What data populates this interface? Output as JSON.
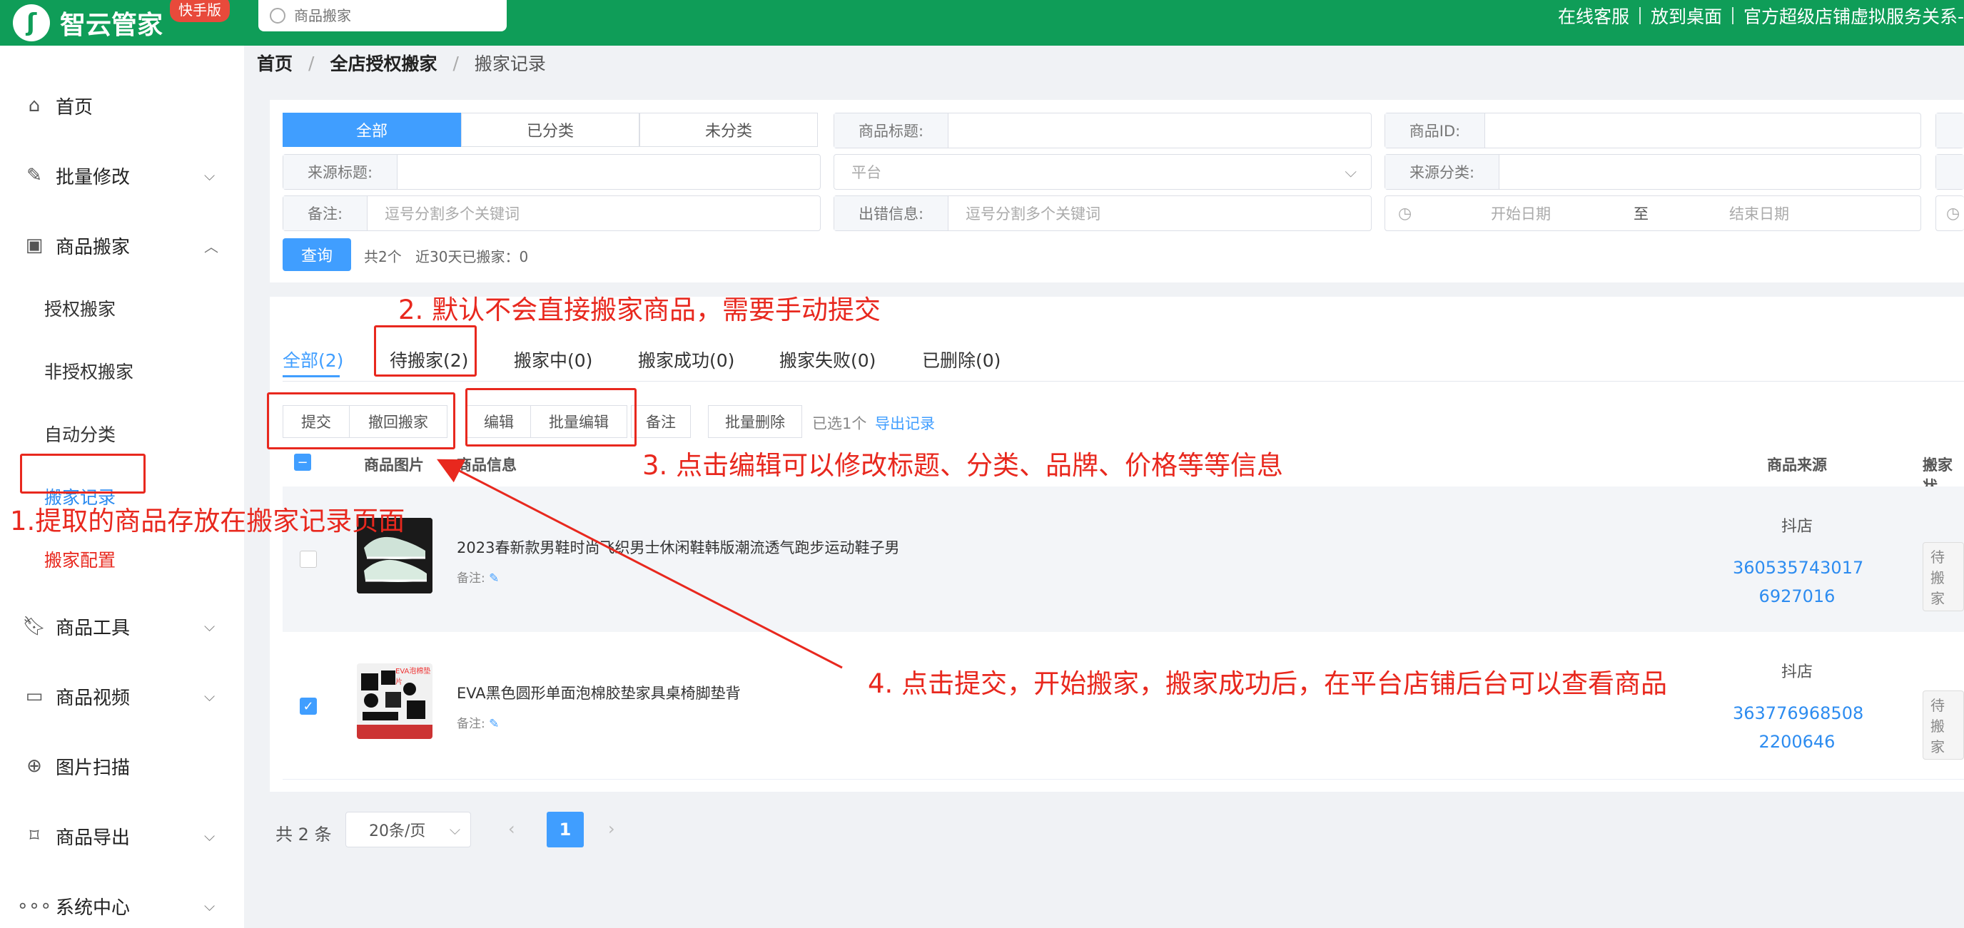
{
  "app": {
    "name": "智云管家",
    "badge": "快手版"
  },
  "search": {
    "placeholder": "商品搬家"
  },
  "toplinks": [
    "在线客服",
    "放到桌面",
    "官方超级店铺虚拟服务关系-"
  ],
  "sidebar": {
    "items": [
      {
        "label": "首页",
        "icon": "home-icon"
      },
      {
        "label": "批量修改",
        "icon": "edit-icon"
      },
      {
        "label": "商品搬家",
        "icon": "move-icon"
      },
      {
        "label": "商品工具",
        "icon": "bookmark-icon"
      },
      {
        "label": "商品视频",
        "icon": "video-icon"
      },
      {
        "label": "图片扫描",
        "icon": "scan-icon"
      },
      {
        "label": "商品导出",
        "icon": "export-icon"
      },
      {
        "label": "系统中心",
        "icon": "more-icon"
      }
    ],
    "subitems": [
      "授权搬家",
      "非授权搬家",
      "自动分类",
      "搬家记录",
      "搬家配置"
    ]
  },
  "breadcrumb": [
    "首页",
    "全店授权搬家",
    "搬家记录"
  ],
  "filters": {
    "segments": [
      "全部",
      "已分类",
      "未分类"
    ],
    "fields": {
      "title_label": "商品标题:",
      "id_label": "商品ID:",
      "source_title_label": "来源标题:",
      "platform_placeholder": "平台",
      "source_category_label": "来源分类:",
      "remark_label": "备注:",
      "remark_placeholder": "逗号分割多个关键词",
      "error_label": "出错信息:",
      "error_placeholder": "逗号分割多个关键词",
      "start_date": "开始日期",
      "to": "至",
      "end_date": "结束日期"
    },
    "query_button": "查询",
    "total": "共2个",
    "recent": "近30天已搬家：0"
  },
  "tabs": [
    "全部(2)",
    "待搬家(2)",
    "搬家中(0)",
    "搬家成功(0)",
    "搬家失败(0)",
    "已删除(0)"
  ],
  "actions": {
    "submit": "提交",
    "revoke": "撤回搬家",
    "edit": "编辑",
    "batch_edit": "批量编辑",
    "remark": "备注",
    "batch_delete": "批量删除",
    "selected": "已选1个",
    "export": "导出记录"
  },
  "table": {
    "headers": {
      "image": "商品图片",
      "info": "商品信息",
      "source": "商品来源",
      "status": "搬家状"
    },
    "rows": [
      {
        "title": "2023春新款男鞋时尚飞织男士休闲鞋韩版潮流透气跑步运动鞋子男",
        "note": "备注:",
        "source": "抖店",
        "id_line1": "360535743017",
        "id_line2": "6927016",
        "status": "待搬家",
        "checked": false
      },
      {
        "title": "EVA黑色圆形单面泡棉胶垫家具桌椅脚垫背",
        "note": "备注:",
        "source": "抖店",
        "id_line1": "363776968508",
        "id_line2": "2200646",
        "status": "待搬家",
        "checked": true,
        "thumb_label": "EVA泡棉垫片"
      }
    ]
  },
  "pagination": {
    "total": "共 2 条",
    "page_size": "20条/页",
    "current": "1"
  },
  "annotations": {
    "a1": "1.提取的商品存放在搬家记录页面",
    "a2": "2. 默认不会直接搬家商品，需要手动提交",
    "a3": "3. 点击编辑可以修改标题、分类、品牌、价格等等信息",
    "a4": "4. 点击提交，开始搬家，搬家成功后，在平台店铺后台可以查看商品"
  },
  "colors": {
    "brand": "#0f9d58",
    "accent": "#409eff",
    "annotation": "#e8281e"
  }
}
